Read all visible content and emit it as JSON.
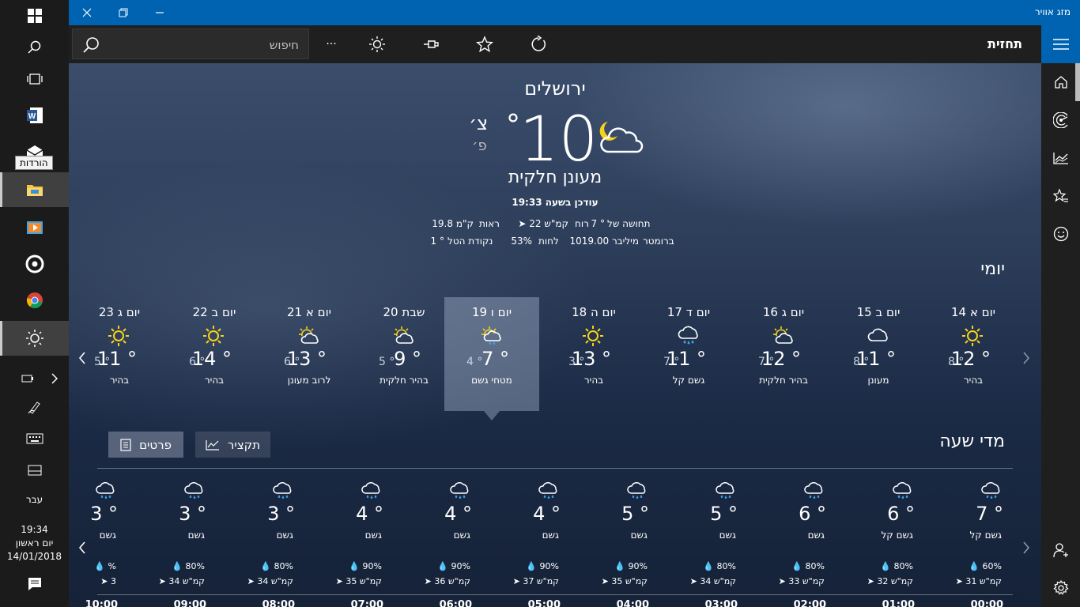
{
  "taskbar": {
    "tooltip": "הורדות",
    "language": "עבר",
    "time": "19:34",
    "weekday": "יום ראשון",
    "date": "14/01/2018"
  },
  "window": {
    "title": "מזג אוויר",
    "accent": "#0063b1"
  },
  "command_bar": {
    "app_section_title": "תחזית",
    "search_placeholder": "חיפוש",
    "more_label": "···"
  },
  "current": {
    "city": "ירושלים",
    "temperature": "10",
    "degree": "°",
    "unit_c": "צ׳",
    "unit_f": "פ׳",
    "condition": "מעונן חלקית",
    "updated": "עודכן בשעה 19:33",
    "details": {
      "feels_like_label": "תחושה של",
      "feels_like_value": "7 °",
      "wind_label": "רוח",
      "wind_value": "22 קמ\"ש",
      "visibility_label": "ראות",
      "visibility_value": "19.8 ק\"מ",
      "barometer_label": "ברומטר",
      "barometer_value": "1019.00 מיליבר",
      "humidity_label": "לחות",
      "humidity_value": "53%",
      "dewpoint_label": "נקודת הטל",
      "dewpoint_value": "1 °"
    }
  },
  "daily": {
    "heading": "יומי",
    "days": [
      {
        "name": "יום א 14",
        "hi": "12 °",
        "lo": "8 °",
        "cond": "בהיר",
        "icon": "sun-icon"
      },
      {
        "name": "יום ב 15",
        "hi": "11 °",
        "lo": "8 °",
        "cond": "מעונן",
        "icon": "cloud-icon"
      },
      {
        "name": "יום ג 16",
        "hi": "12 °",
        "lo": "7 °",
        "cond": "בהיר חלקית",
        "icon": "partly-sunny-icon"
      },
      {
        "name": "יום ד 17",
        "hi": "11 °",
        "lo": "7 °",
        "cond": "גשם קל",
        "icon": "rain-icon"
      },
      {
        "name": "יום ה 18",
        "hi": "13 °",
        "lo": "3 °",
        "cond": "בהיר",
        "icon": "sun-icon"
      },
      {
        "name": "יום ו 19",
        "hi": "7 °",
        "lo": "4 °",
        "cond": "מטחי גשם",
        "icon": "sun-rain-icon"
      },
      {
        "name": "שבת 20",
        "hi": "9 °",
        "lo": "5 °",
        "cond": "בהיר חלקית",
        "icon": "partly-sunny-icon"
      },
      {
        "name": "יום א 21",
        "hi": "13 °",
        "lo": "6 °",
        "cond": "לרוב מעונן",
        "icon": "partly-sunny-icon"
      },
      {
        "name": "יום ב 22",
        "hi": "14 °",
        "lo": "6 °",
        "cond": "בהיר",
        "icon": "sun-icon"
      },
      {
        "name": "יום ג 23",
        "hi": "11 °",
        "lo": "5 °",
        "cond": "בהיר",
        "icon": "sun-icon"
      }
    ]
  },
  "hourly": {
    "heading": "מדי שעה",
    "tab_summary": "תקציר",
    "tab_details": "פרטים",
    "hours": [
      {
        "temp": "7 °",
        "cond": "גשם קל",
        "precip": "60%",
        "wind": "31 קמ\"ש",
        "time": "00:00"
      },
      {
        "temp": "6 °",
        "cond": "גשם קל",
        "precip": "80%",
        "wind": "32 קמ\"ש",
        "time": "01:00"
      },
      {
        "temp": "6 °",
        "cond": "גשם",
        "precip": "80%",
        "wind": "33 קמ\"ש",
        "time": "02:00"
      },
      {
        "temp": "5 °",
        "cond": "גשם",
        "precip": "80%",
        "wind": "34 קמ\"ש",
        "time": "03:00"
      },
      {
        "temp": "5 °",
        "cond": "גשם",
        "precip": "90%",
        "wind": "35 קמ\"ש",
        "time": "04:00"
      },
      {
        "temp": "4 °",
        "cond": "גשם",
        "precip": "90%",
        "wind": "37 קמ\"ש",
        "time": "05:00"
      },
      {
        "temp": "4 °",
        "cond": "גשם",
        "precip": "90%",
        "wind": "36 קמ\"ש",
        "time": "06:00"
      },
      {
        "temp": "4 °",
        "cond": "גשם",
        "precip": "90%",
        "wind": "35 קמ\"ש",
        "time": "07:00"
      },
      {
        "temp": "3 °",
        "cond": "גשם",
        "precip": "80%",
        "wind": "34 קמ\"ש",
        "time": "08:00"
      },
      {
        "temp": "3 °",
        "cond": "גשם",
        "precip": "80%",
        "wind": "34 קמ\"ש",
        "time": "09:00"
      },
      {
        "temp": "3 °",
        "cond": "גשם",
        "precip": "%",
        "wind": "3",
        "time": "10:00"
      }
    ]
  }
}
